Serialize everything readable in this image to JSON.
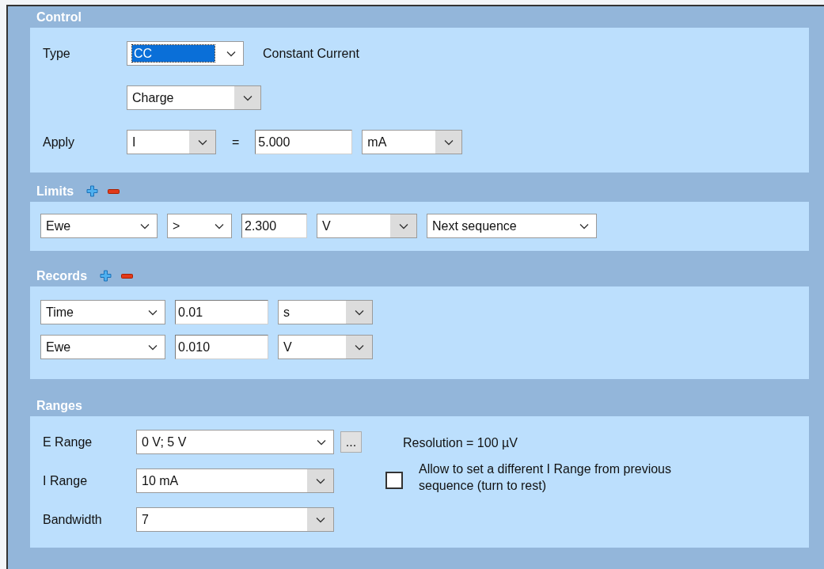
{
  "control": {
    "title": "Control",
    "rows": [
      {
        "label": "Type",
        "fields": [
          {
            "kind": "select",
            "value": "CC",
            "shaded": false,
            "focused": true
          },
          {
            "kind": "text",
            "value": "Constant Current"
          }
        ]
      },
      {
        "fields": [
          {
            "kind": "select",
            "value": "Charge",
            "shaded": true,
            "focused": false
          }
        ]
      },
      {
        "label": "Apply",
        "fields": [
          {
            "kind": "select",
            "value": "I",
            "shaded": true,
            "focused": false
          },
          {
            "kind": "sign",
            "value": "="
          },
          {
            "kind": "input",
            "value": "5.000"
          },
          {
            "kind": "select",
            "value": "mA",
            "shaded": true,
            "focused": false
          }
        ]
      }
    ]
  },
  "limits": {
    "title": "Limits",
    "rows": [
      {
        "fields": [
          {
            "kind": "select",
            "value": "Ewe",
            "shaded": false,
            "focused": false
          },
          {
            "kind": "select",
            "value": ">",
            "shaded": false,
            "focused": false
          },
          {
            "kind": "input",
            "value": "2.300"
          },
          {
            "kind": "select",
            "value": "V",
            "shaded": true,
            "focused": false
          },
          {
            "kind": "select",
            "value": "Next sequence",
            "shaded": false,
            "focused": false
          }
        ]
      }
    ]
  },
  "records": {
    "title": "Records",
    "rows": [
      {
        "fields": [
          {
            "kind": "select",
            "value": "Time",
            "shaded": false,
            "focused": false
          },
          {
            "kind": "input",
            "value": "0.01"
          },
          {
            "kind": "select",
            "value": "s",
            "shaded": true,
            "focused": false
          }
        ]
      },
      {
        "fields": [
          {
            "kind": "select",
            "value": "Ewe",
            "shaded": false,
            "focused": false
          },
          {
            "kind": "input",
            "value": "0.010"
          },
          {
            "kind": "select",
            "value": "V",
            "shaded": true,
            "focused": false
          }
        ]
      }
    ]
  },
  "ranges": {
    "title": "Ranges",
    "rows": [
      {
        "label": "E Range",
        "fields": [
          {
            "kind": "select",
            "value": "0 V; 5 V",
            "shaded": false,
            "focused": false
          },
          {
            "kind": "button",
            "value": "..."
          }
        ]
      },
      {
        "label": "I Range",
        "fields": [
          {
            "kind": "select",
            "value": "10 mA",
            "shaded": true,
            "focused": false
          }
        ]
      },
      {
        "label": "Bandwidth",
        "fields": [
          {
            "kind": "select",
            "value": "7",
            "shaded": true,
            "focused": false
          }
        ]
      }
    ],
    "resolution": "Resolution = 100 µV",
    "checkbox": {
      "label": "Allow to set a different I Range from previous sequence (turn to rest)",
      "checked": false
    }
  }
}
